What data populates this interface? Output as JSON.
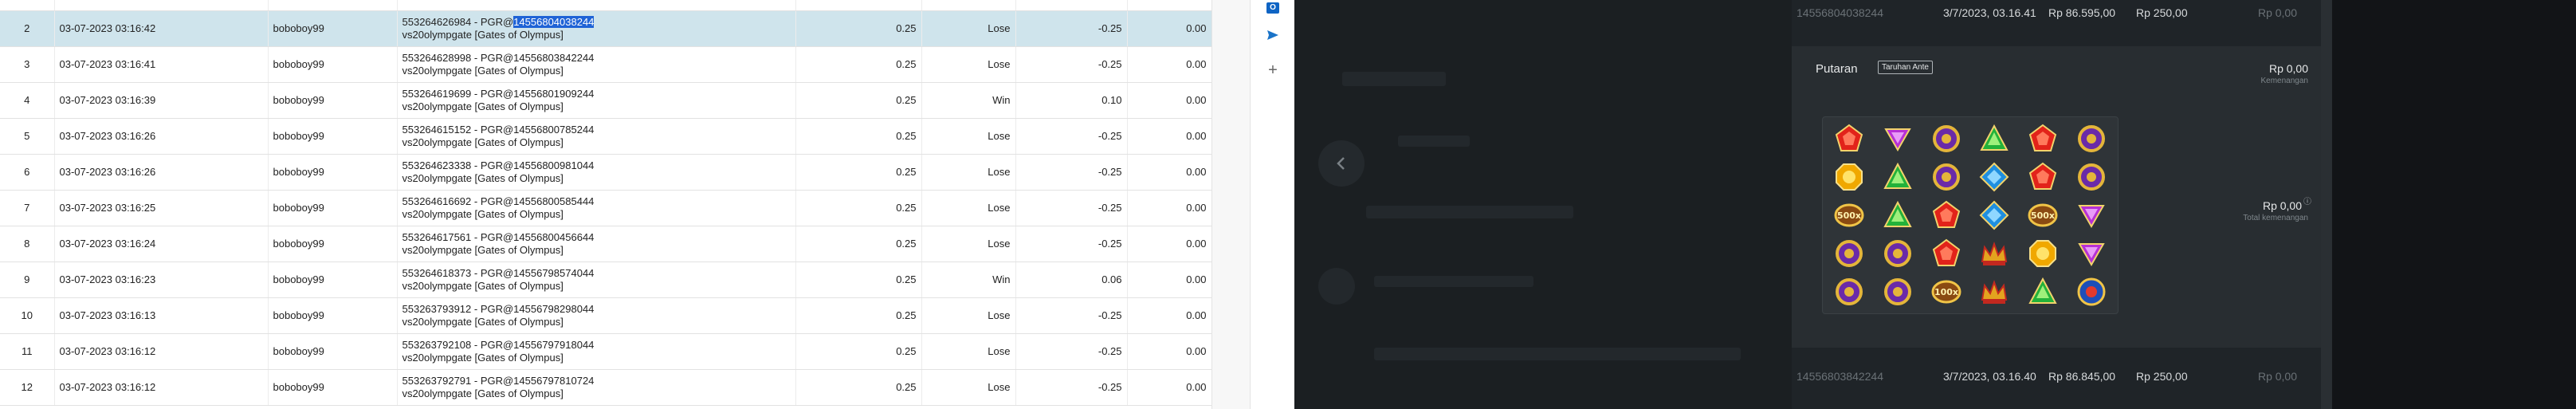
{
  "table": {
    "rows": [
      {
        "no": "",
        "date": "",
        "user": "",
        "desc1": "",
        "desc2": "vs20olympgate [Gates of Olympus]",
        "bet": "",
        "result": "",
        "result_kind": "",
        "amount": "",
        "amount_kind": "",
        "balance": "",
        "selected": false
      },
      {
        "no": "2",
        "date": "03-07-2023 03:16:42",
        "user": "boboboy99",
        "desc1_pre": "553264626984 - PGR@",
        "desc1_hl": "14556804038244",
        "desc2": "vs20olympgate [Gates of Olympus]",
        "bet": "0.25",
        "result": "Lose",
        "result_kind": "lose",
        "amount": "-0.25",
        "amount_kind": "neg",
        "balance": "0.00",
        "selected": true
      },
      {
        "no": "3",
        "date": "03-07-2023 03:16:41",
        "user": "boboboy99",
        "desc1": "553264628998 - PGR@14556803842244",
        "desc2": "vs20olympgate [Gates of Olympus]",
        "bet": "0.25",
        "result": "Lose",
        "result_kind": "lose",
        "amount": "-0.25",
        "amount_kind": "neg",
        "balance": "0.00",
        "selected": false
      },
      {
        "no": "4",
        "date": "03-07-2023 03:16:39",
        "user": "boboboy99",
        "desc1": "553264619699 - PGR@14556801909244",
        "desc2": "vs20olympgate [Gates of Olympus]",
        "bet": "0.25",
        "result": "Win",
        "result_kind": "win",
        "amount": "0.10",
        "amount_kind": "pos",
        "balance": "0.00",
        "selected": false
      },
      {
        "no": "5",
        "date": "03-07-2023 03:16:26",
        "user": "boboboy99",
        "desc1": "553264615152 - PGR@14556800785244",
        "desc2": "vs20olympgate [Gates of Olympus]",
        "bet": "0.25",
        "result": "Lose",
        "result_kind": "lose",
        "amount": "-0.25",
        "amount_kind": "neg",
        "balance": "0.00",
        "selected": false
      },
      {
        "no": "6",
        "date": "03-07-2023 03:16:26",
        "user": "boboboy99",
        "desc1": "553264623338 - PGR@14556800981044",
        "desc2": "vs20olympgate [Gates of Olympus]",
        "bet": "0.25",
        "result": "Lose",
        "result_kind": "lose",
        "amount": "-0.25",
        "amount_kind": "neg",
        "balance": "0.00",
        "selected": false
      },
      {
        "no": "7",
        "date": "03-07-2023 03:16:25",
        "user": "boboboy99",
        "desc1": "553264616692 - PGR@14556800585444",
        "desc2": "vs20olympgate [Gates of Olympus]",
        "bet": "0.25",
        "result": "Lose",
        "result_kind": "lose",
        "amount": "-0.25",
        "amount_kind": "neg",
        "balance": "0.00",
        "selected": false
      },
      {
        "no": "8",
        "date": "03-07-2023 03:16:24",
        "user": "boboboy99",
        "desc1": "553264617561 - PGR@14556800456644",
        "desc2": "vs20olympgate [Gates of Olympus]",
        "bet": "0.25",
        "result": "Lose",
        "result_kind": "lose",
        "amount": "-0.25",
        "amount_kind": "neg",
        "balance": "0.00",
        "selected": false
      },
      {
        "no": "9",
        "date": "03-07-2023 03:16:23",
        "user": "boboboy99",
        "desc1": "553264618373 - PGR@14556798574044",
        "desc2": "vs20olympgate [Gates of Olympus]",
        "bet": "0.25",
        "result": "Win",
        "result_kind": "win",
        "amount": "0.06",
        "amount_kind": "pos",
        "balance": "0.00",
        "selected": false
      },
      {
        "no": "10",
        "date": "03-07-2023 03:16:13",
        "user": "boboboy99",
        "desc1": "553263793912 - PGR@14556798298044",
        "desc2": "vs20olympgate [Gates of Olympus]",
        "bet": "0.25",
        "result": "Lose",
        "result_kind": "lose",
        "amount": "-0.25",
        "amount_kind": "neg",
        "balance": "0.00",
        "selected": false
      },
      {
        "no": "11",
        "date": "03-07-2023 03:16:12",
        "user": "boboboy99",
        "desc1": "553263792108 - PGR@14556797918044",
        "desc2": "vs20olympgate [Gates of Olympus]",
        "bet": "0.25",
        "result": "Lose",
        "result_kind": "lose",
        "amount": "-0.25",
        "amount_kind": "neg",
        "balance": "0.00",
        "selected": false
      },
      {
        "no": "12",
        "date": "03-07-2023 03:16:12",
        "user": "boboboy99",
        "desc1": "553263792791 - PGR@14556797810724",
        "desc2": "vs20olympgate [Gates of Olympus]",
        "bet": "0.25",
        "result": "Lose",
        "result_kind": "lose",
        "amount": "-0.25",
        "amount_kind": "neg",
        "balance": "0.00",
        "selected": false
      }
    ]
  },
  "side_strip": {
    "outlook_icon": "outlook-icon",
    "send_icon": "send-icon",
    "add_icon": "plus-icon",
    "outlook_label": "O"
  },
  "history": {
    "top_row": {
      "id": "14556804038244",
      "date": "3/7/2023, 03.16.41",
      "balance": "Rp 86.595,00",
      "bet": "Rp 250,00",
      "win": "Rp 0,00"
    },
    "bottom_row": {
      "id": "14556803842244",
      "date": "3/7/2023, 03.16.40",
      "balance": "Rp 86.845,00",
      "bet": "Rp 250,00",
      "win": "Rp 0,00"
    },
    "spin": {
      "title": "Putaran",
      "badge": "Taruhan Ante",
      "win_amount": "Rp 0,00",
      "win_label": "Kemenangan",
      "total_amount": "Rp 0,00",
      "total_label": "Total kemenangan",
      "reels": [
        [
          "red-gem",
          "purple-gem",
          "ring",
          "green-gem",
          "red-gem",
          "ring"
        ],
        [
          "sun-gem",
          "green-gem",
          "ring",
          "blue-gem",
          "red-gem",
          "ring"
        ],
        [
          "multiplier-500x",
          "green-gem",
          "red-gem",
          "blue-gem",
          "multiplier-500x",
          "purple-gem"
        ],
        [
          "ring",
          "ring",
          "red-gem",
          "crown",
          "sun-gem",
          "purple-gem"
        ],
        [
          "ring",
          "ring",
          "multiplier-100x",
          "crown",
          "green-gem",
          "scatter"
        ]
      ],
      "multiplier_labels": {
        "multiplier-500x": "500x",
        "multiplier-100x": "100x"
      }
    }
  },
  "colors": {
    "lose": "#e0201c",
    "win": "#1e9a22",
    "selected_row": "#cfe4ec",
    "highlight": "#1f63d6",
    "dark_bg": "#1c2023"
  }
}
